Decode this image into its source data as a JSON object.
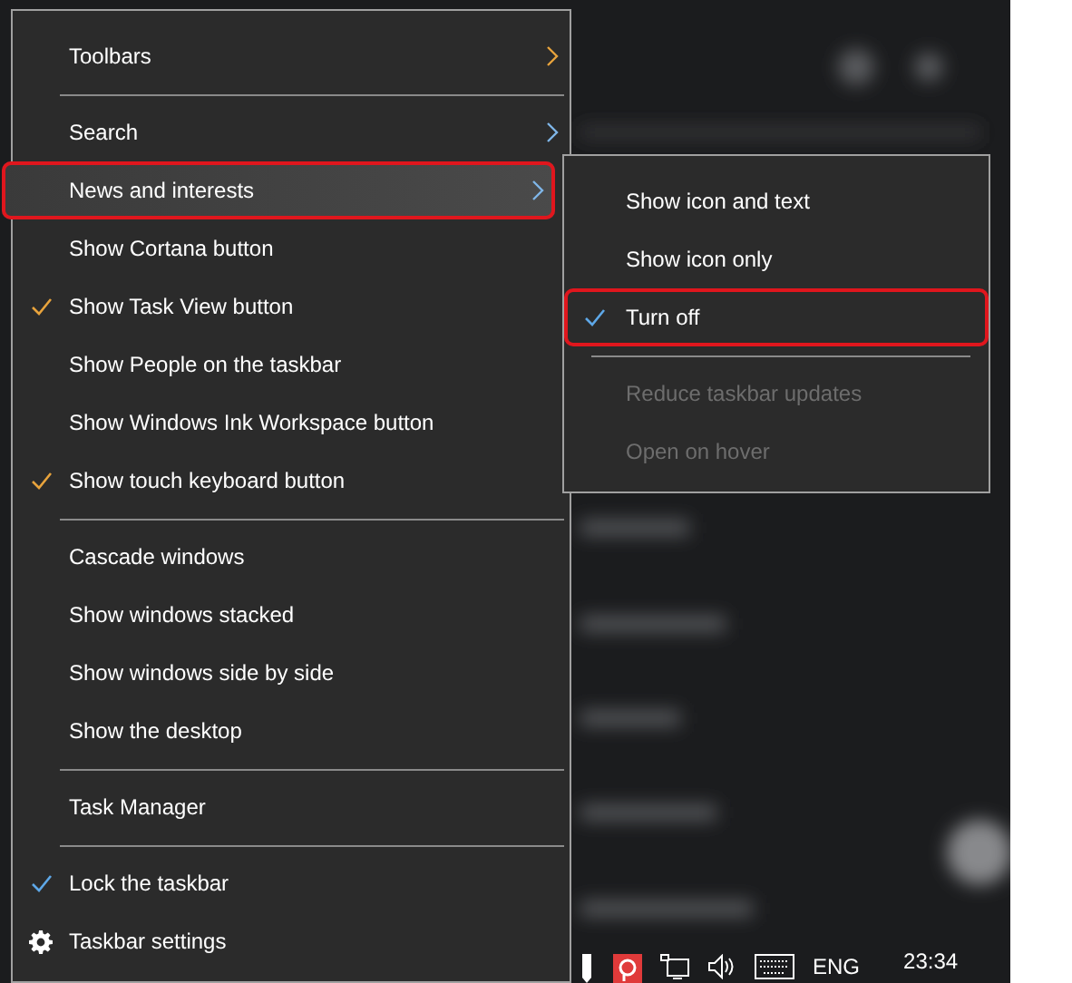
{
  "context_menu": {
    "items": [
      {
        "kind": "item",
        "label": "Toolbars",
        "submenu": true,
        "checked": false,
        "hovered": false,
        "annotated": false
      },
      {
        "kind": "separator"
      },
      {
        "kind": "item",
        "label": "Search",
        "submenu": true,
        "checked": false,
        "hovered": false,
        "annotated": false
      },
      {
        "kind": "item",
        "label": "News and interests",
        "submenu": true,
        "checked": false,
        "hovered": true,
        "annotated": true
      },
      {
        "kind": "item",
        "label": "Show Cortana button",
        "submenu": false,
        "checked": false,
        "hovered": false,
        "annotated": false
      },
      {
        "kind": "item",
        "label": "Show Task View button",
        "submenu": false,
        "checked": true,
        "color": "#e8a33c",
        "hovered": false,
        "annotated": false
      },
      {
        "kind": "item",
        "label": "Show People on the taskbar",
        "submenu": false,
        "checked": false,
        "hovered": false,
        "annotated": false
      },
      {
        "kind": "item",
        "label": "Show Windows Ink Workspace button",
        "submenu": false,
        "checked": false,
        "hovered": false,
        "annotated": false
      },
      {
        "kind": "item",
        "label": "Show touch keyboard button",
        "submenu": false,
        "checked": true,
        "color": "#e8a33c",
        "hovered": false,
        "annotated": false
      },
      {
        "kind": "separator"
      },
      {
        "kind": "item",
        "label": "Cascade windows",
        "submenu": false,
        "checked": false,
        "hovered": false,
        "annotated": false
      },
      {
        "kind": "item",
        "label": "Show windows stacked",
        "submenu": false,
        "checked": false,
        "hovered": false,
        "annotated": false
      },
      {
        "kind": "item",
        "label": "Show windows side by side",
        "submenu": false,
        "checked": false,
        "hovered": false,
        "annotated": false
      },
      {
        "kind": "item",
        "label": "Show the desktop",
        "submenu": false,
        "checked": false,
        "hovered": false,
        "annotated": false
      },
      {
        "kind": "separator"
      },
      {
        "kind": "item",
        "label": "Task Manager",
        "submenu": false,
        "checked": false,
        "hovered": false,
        "annotated": false
      },
      {
        "kind": "separator"
      },
      {
        "kind": "item",
        "label": "Lock the taskbar",
        "submenu": false,
        "checked": true,
        "color": "#5ea8e8",
        "hovered": false,
        "annotated": false
      },
      {
        "kind": "settings",
        "label": "Taskbar settings",
        "submenu": false,
        "hovered": false,
        "annotated": false
      }
    ]
  },
  "submenu": {
    "items": [
      {
        "kind": "item",
        "label": "Show icon and text",
        "checked": false,
        "disabled": false,
        "annotated": false
      },
      {
        "kind": "item",
        "label": "Show icon only",
        "checked": false,
        "disabled": false,
        "annotated": false
      },
      {
        "kind": "item",
        "label": "Turn off",
        "checked": true,
        "color": "#5ea8e8",
        "disabled": false,
        "annotated": true
      },
      {
        "kind": "separator"
      },
      {
        "kind": "item",
        "label": "Reduce taskbar updates",
        "checked": false,
        "disabled": true,
        "annotated": false
      },
      {
        "kind": "item",
        "label": "Open on hover",
        "checked": false,
        "disabled": true,
        "annotated": false
      }
    ]
  },
  "taskbar": {
    "language": "ENG",
    "time": "23:34"
  }
}
